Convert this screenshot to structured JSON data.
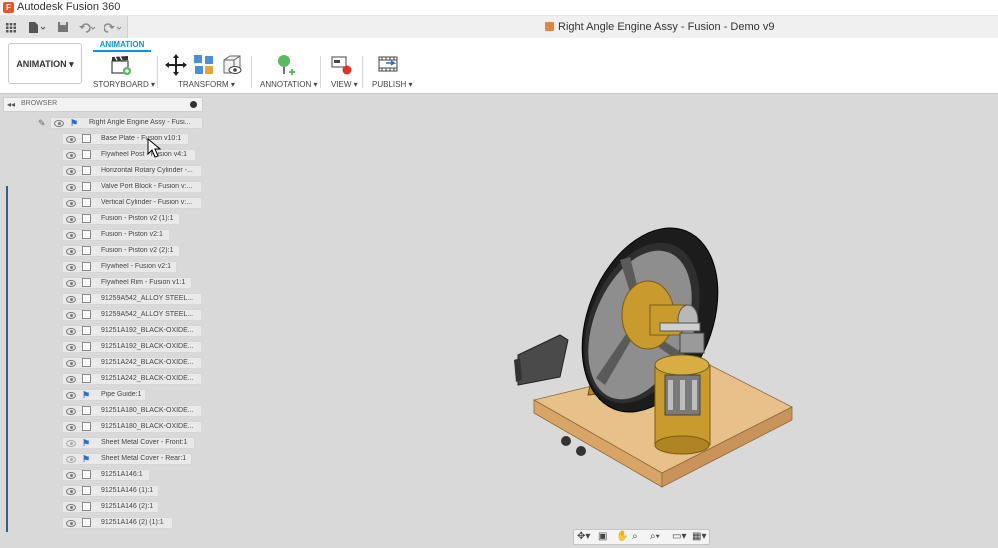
{
  "app": {
    "title": "Autodesk Fusion 360",
    "logo_letter": "F"
  },
  "document": {
    "title": "Right Angle Engine Assy - Fusion - Demo v9"
  },
  "toolbar": {
    "workspace_label": "ANIMATION",
    "active_tab": "ANIMATION",
    "groups": {
      "storyboard": "STORYBOARD ▾",
      "transform": "TRANSFORM ▾",
      "annotation": "ANNOTATION ▾",
      "view": "VIEW ▾",
      "publish": "PUBLISH ▾"
    }
  },
  "browser": {
    "title": "BROWSER",
    "root": "Right Angle Engine Assy - Fusi...",
    "items": [
      {
        "label": "Base Plate - Fusion v10:1",
        "type": "component",
        "visible": true
      },
      {
        "label": "Flywheel Post - Fusion v4:1",
        "type": "component",
        "visible": true
      },
      {
        "label": "Horizontal Rotary Cylinder -...",
        "type": "component",
        "visible": true
      },
      {
        "label": "Valve Port Block - Fusion v:...",
        "type": "component",
        "visible": true
      },
      {
        "label": "Vertical Cylinder - Fusion v:...",
        "type": "component",
        "visible": true
      },
      {
        "label": "Fusion - Piston v2 (1):1",
        "type": "component",
        "visible": true
      },
      {
        "label": "Fusion - Piston v2:1",
        "type": "component",
        "visible": true
      },
      {
        "label": "Fusion - Piston v2 (2):1",
        "type": "component",
        "visible": true
      },
      {
        "label": "Flywheel - Fusion v2:1",
        "type": "component",
        "visible": true
      },
      {
        "label": "Flywheel Rim - Fusion v1:1",
        "type": "component",
        "visible": true
      },
      {
        "label": "91259A542_ALLOY STEEL...",
        "type": "component",
        "visible": true
      },
      {
        "label": "91259A542_ALLOY STEEL...",
        "type": "component",
        "visible": true
      },
      {
        "label": "91251A192_BLACK-OXIDE...",
        "type": "component",
        "visible": true
      },
      {
        "label": "91251A192_BLACK-OXIDE...",
        "type": "component",
        "visible": true
      },
      {
        "label": "91251A242_BLACK-OXIDE...",
        "type": "component",
        "visible": true
      },
      {
        "label": "91251A242_BLACK-OXIDE...",
        "type": "component",
        "visible": true
      },
      {
        "label": "Pipe Guide:1",
        "type": "assembly",
        "visible": true
      },
      {
        "label": "91251A180_BLACK-OXIDE...",
        "type": "component",
        "visible": true
      },
      {
        "label": "91251A180_BLACK-OXIDE...",
        "type": "component",
        "visible": true
      },
      {
        "label": "Sheet Metal Cover - Front:1",
        "type": "assembly",
        "visible": false
      },
      {
        "label": "Sheet Metal Cover - Rear:1",
        "type": "assembly",
        "visible": false
      },
      {
        "label": "91251A146:1",
        "type": "component",
        "visible": true
      },
      {
        "label": "91251A146 (1):1",
        "type": "component",
        "visible": true
      },
      {
        "label": "91251A146 (2):1",
        "type": "component",
        "visible": true
      },
      {
        "label": "91251A146 (2) (1):1",
        "type": "component",
        "visible": true
      }
    ]
  },
  "navbar": {
    "icons": [
      "orbit-icon",
      "look-at-icon",
      "pan-icon",
      "zoom-window-icon",
      "zoom-icon",
      "display-settings-icon",
      "grid-settings-icon"
    ]
  },
  "colors": {
    "accent": "#0696d7",
    "viewport_bg": "#d9d9d9",
    "wood": "#e6b87a",
    "brass": "#c99a2e"
  }
}
